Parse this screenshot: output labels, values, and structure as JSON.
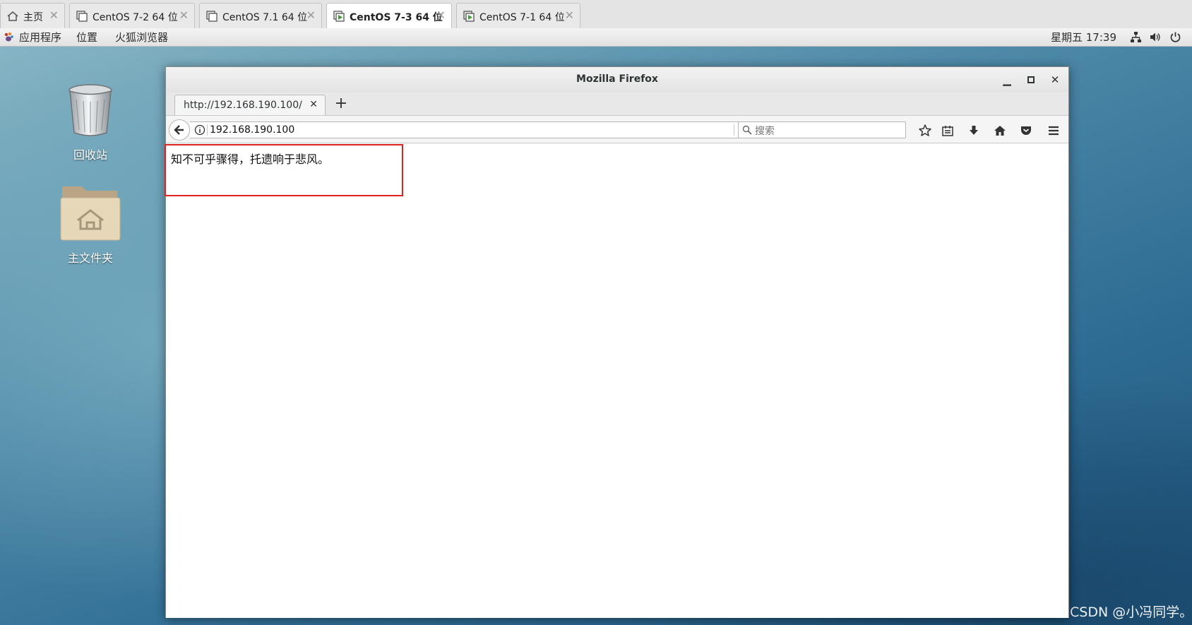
{
  "vm_tabs": [
    {
      "label": "主页",
      "icon": "home-icon",
      "active": false
    },
    {
      "label": "CentOS 7-2 64 位",
      "icon": "vm-icon",
      "active": false
    },
    {
      "label": "CentOS 7.1 64 位",
      "icon": "vm-icon",
      "active": false
    },
    {
      "label": "CentOS 7-3 64 位",
      "icon": "vm-running-icon",
      "active": true
    },
    {
      "label": "CentOS 7-1 64 位",
      "icon": "vm-running-icon",
      "active": false
    }
  ],
  "panel": {
    "applications": "应用程序",
    "places": "位置",
    "firefox": "火狐浏览器",
    "clock": "星期五 17:39"
  },
  "desktop": {
    "trash_label": "回收站",
    "home_label": "主文件夹",
    "watermark": "CSDN @小冯同学。"
  },
  "firefox": {
    "window_title": "Mozilla Firefox",
    "tab_title": "http://192.168.190.100/",
    "url": "192.168.190.100",
    "search_placeholder": "搜索",
    "page_text": "知不可乎骤得，托遗响于悲风。"
  },
  "colors": {
    "highlight_box": "#e0221f",
    "running_vm": "#3f9c35"
  }
}
